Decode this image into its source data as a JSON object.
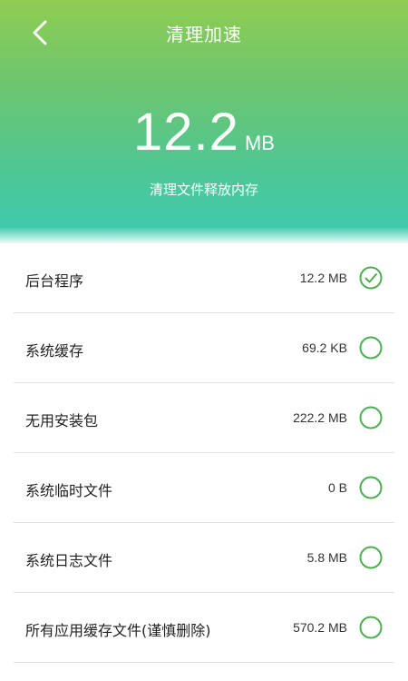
{
  "header": {
    "title": "清理加速",
    "size_value": "12.2",
    "size_unit": "MB",
    "subtitle": "清理文件释放内存",
    "back_icon": "chevron-left-icon"
  },
  "colors": {
    "gradient_top": "#8fcd52",
    "gradient_bottom": "#3ecab2",
    "accent": "#4caf50",
    "divider": "#e3e3e3"
  },
  "items": [
    {
      "label": "后台程序",
      "size": "12.2 MB",
      "checked": true
    },
    {
      "label": "系统缓存",
      "size": "69.2 KB",
      "checked": false
    },
    {
      "label": "无用安装包",
      "size": "222.2 MB",
      "checked": false
    },
    {
      "label": "系统临时文件",
      "size": "0 B",
      "checked": false
    },
    {
      "label": "系统日志文件",
      "size": "5.8 MB",
      "checked": false
    },
    {
      "label": "所有应用缓存文件(谨慎删除)",
      "size": "570.2 MB",
      "checked": false
    }
  ]
}
